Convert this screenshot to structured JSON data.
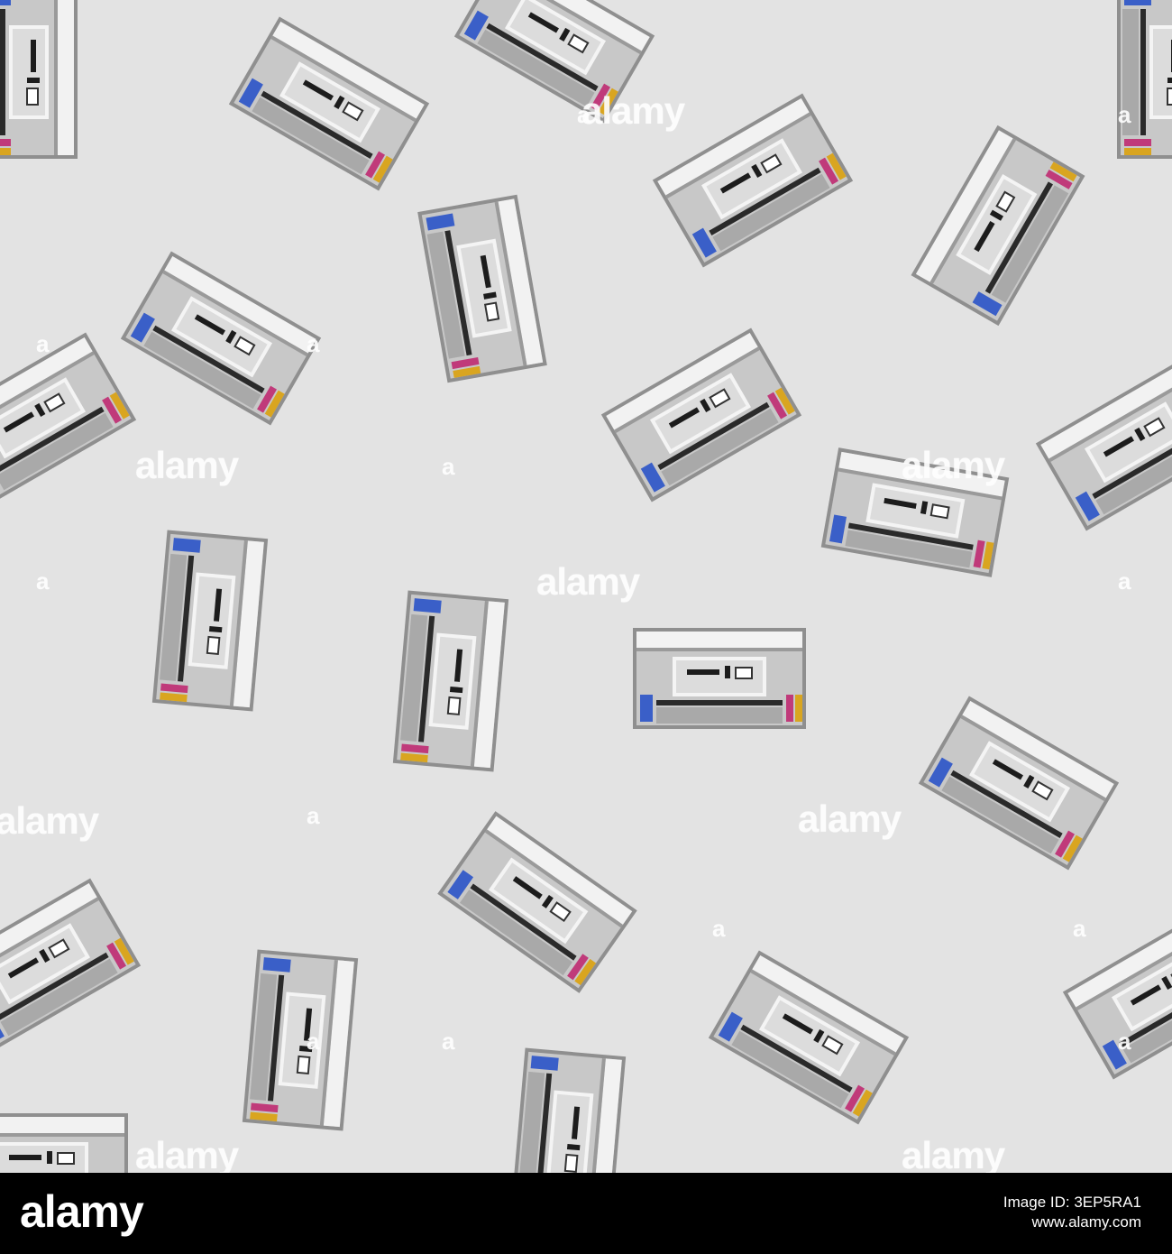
{
  "watermark": {
    "word": "alamy",
    "mark": "a"
  },
  "footer": {
    "logo": "alamy",
    "image_id": "Image ID: 3EP5RA1",
    "site": "www.alamy.com"
  },
  "colors": {
    "background": "#e3e3e3",
    "printer_body": "#c8c8c8",
    "printer_top": "#f2f2f2",
    "ink_blue": "#3a5fc8",
    "ink_magenta": "#c03a7a",
    "ink_yellow": "#d9a520",
    "footer": "#000000"
  },
  "icon": "pixel-printer-icon"
}
